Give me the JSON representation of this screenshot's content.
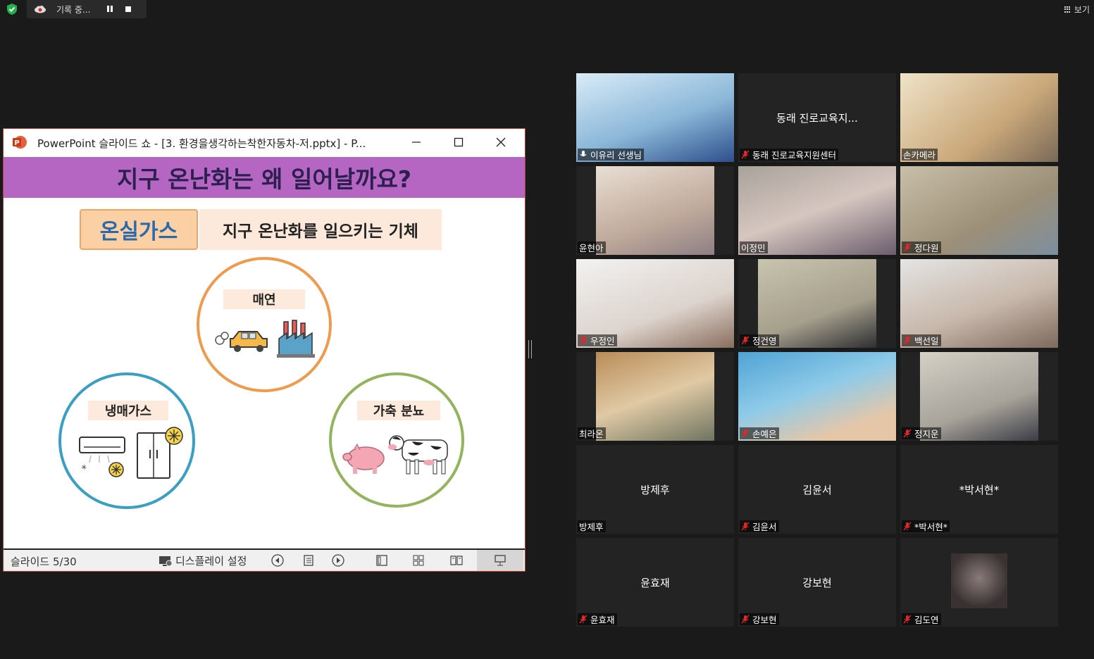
{
  "topbar": {
    "recording_label": "기록 중...",
    "view_label": "보기"
  },
  "ppt": {
    "window_title": "PowerPoint 슬라이드 쇼 - [3. 환경을생각하는착한자동차-저.pptx] - P...",
    "slide": {
      "title": "지구 온난화는 왜 일어날까요?",
      "keyword": "온실가스",
      "keyword_desc": "지구 온난화를 일으키는 기체",
      "circles": [
        {
          "label": "매연"
        },
        {
          "label": "냉매가스"
        },
        {
          "label": "가축 분뇨"
        }
      ]
    },
    "status": {
      "slide_counter": "슬라이드 5/30",
      "display_settings": "디스플레이 설정"
    }
  },
  "colors": {
    "banner": "#b566c2",
    "active_speaker_border": "#e4e471",
    "muted_mic": "#e02828",
    "recording": "#e02828"
  },
  "participants": [
    {
      "name": "이유리 선생님",
      "muted": false,
      "video": true,
      "active": true
    },
    {
      "name": "동래 진로교육지원센터",
      "center_name": "동래 진로교육지...",
      "muted": true,
      "video": false
    },
    {
      "name": "손카메라",
      "muted": false,
      "video": true
    },
    {
      "name": "윤현아",
      "muted": false,
      "video": true
    },
    {
      "name": "이정민",
      "muted": false,
      "video": true
    },
    {
      "name": "정다원",
      "muted": true,
      "video": true
    },
    {
      "name": "우정인",
      "muted": true,
      "video": true
    },
    {
      "name": "정건영",
      "muted": true,
      "video": true
    },
    {
      "name": "백선일",
      "muted": true,
      "video": true
    },
    {
      "name": "최라온",
      "muted": false,
      "video": true
    },
    {
      "name": "손예은",
      "muted": true,
      "video": true
    },
    {
      "name": "정지운",
      "muted": true,
      "video": true
    },
    {
      "name": "방제후",
      "center_name": "방제후",
      "muted": false,
      "video": false
    },
    {
      "name": "김윤서",
      "center_name": "김윤서",
      "muted": true,
      "video": false
    },
    {
      "name": "*박서현*",
      "center_name": "*박서현*",
      "muted": true,
      "video": false
    },
    {
      "name": "윤효재",
      "center_name": "윤효재",
      "muted": true,
      "video": false
    },
    {
      "name": "강보현",
      "center_name": "강보현",
      "muted": true,
      "video": false
    },
    {
      "name": "김도연",
      "muted": true,
      "video": true
    }
  ]
}
